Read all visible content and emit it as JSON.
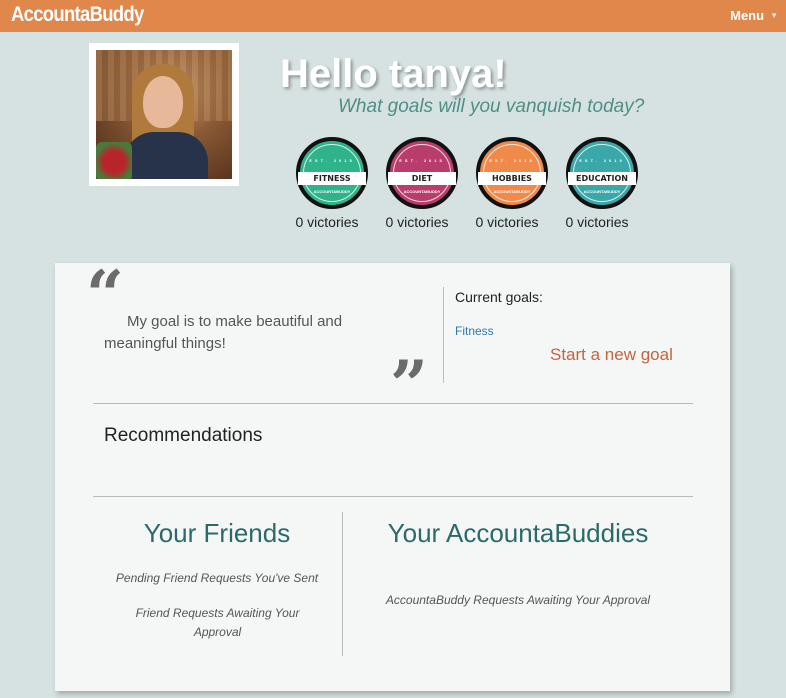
{
  "nav": {
    "brand": "AccountaBuddy",
    "menu_label": "Menu"
  },
  "profile": {
    "greeting": "Hello tanya!",
    "subtitle": "What goals will you vanquish today?"
  },
  "badges": [
    {
      "label": "FITNESS",
      "color": "#2fb38a",
      "est": "EST. 2015",
      "foot": "ACCOUNTABUDDY",
      "victories": "0 victories"
    },
    {
      "label": "DIET",
      "color": "#b83c6c",
      "est": "EST. 2015",
      "foot": "ACCOUNTABUDDY",
      "victories": "0 victories"
    },
    {
      "label": "HOBBIES",
      "color": "#f08a4b",
      "est": "EST. 2015",
      "foot": "ACCOUNTABUDDY",
      "victories": "0 victories"
    },
    {
      "label": "EDUCATION",
      "color": "#3aa8a8",
      "est": "EST. 2015",
      "foot": "ACCOUNTABUDDY",
      "victories": "0 victories"
    }
  ],
  "quote": {
    "open_mark": "“",
    "close_mark": "”",
    "text": "My goal is to make beautiful and meaningful things!"
  },
  "goals": {
    "current_label": "Current goals:",
    "items": [
      "Fitness"
    ],
    "new_goal_label": "Start a new goal"
  },
  "recommendations": {
    "title": "Recommendations"
  },
  "friends": {
    "title": "Your Friends",
    "pending_sent": "Pending Friend Requests You've Sent",
    "awaiting": "Friend Requests Awaiting Your Approval"
  },
  "buddies": {
    "title": "Your AccountaBuddies",
    "awaiting": "AccountaBuddy Requests Awaiting Your Approval"
  }
}
